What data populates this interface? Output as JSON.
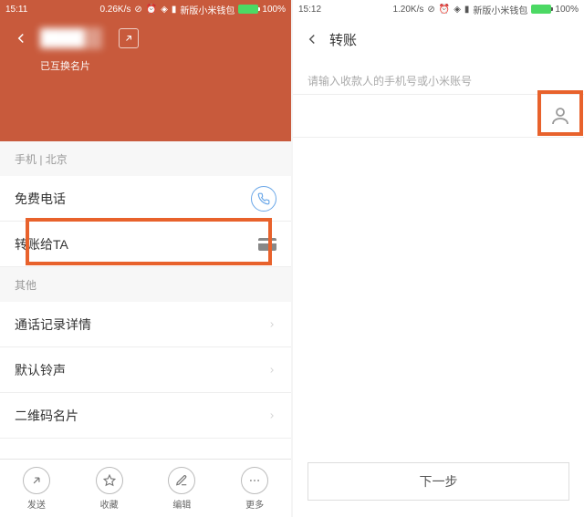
{
  "left": {
    "status": {
      "time": "15:11",
      "speed": "0.26K/s",
      "label": "新版小米钱包",
      "battery": "100%"
    },
    "header": {
      "subtitle": "已互换名片"
    },
    "row_info": "手机 | 北京",
    "row_freecall": "免费电话",
    "row_transfer": "转账给TA",
    "section_other": "其他",
    "row_calllog": "通话记录详情",
    "row_ringtone": "默认铃声",
    "row_qrcard": "二维码名片",
    "bottom": {
      "send": "发送",
      "fav": "收藏",
      "edit": "编辑",
      "more": "更多"
    }
  },
  "right": {
    "status": {
      "time": "15:12",
      "speed": "1.20K/s",
      "label": "新版小米钱包",
      "battery": "100%"
    },
    "nav_title": "转账",
    "hint": "请输入收款人的手机号或小米账号",
    "next": "下一步"
  }
}
